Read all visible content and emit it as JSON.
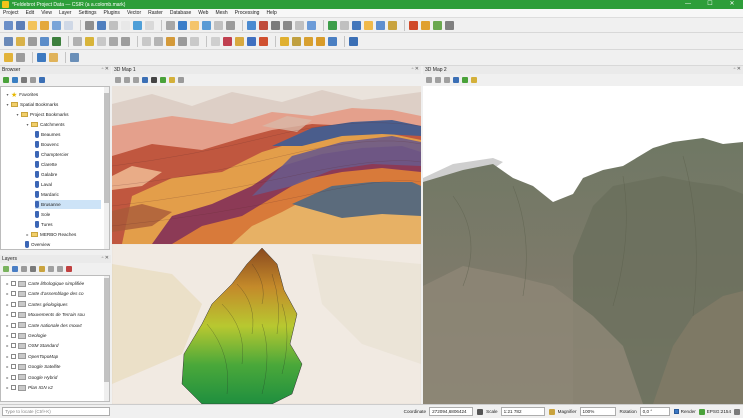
{
  "window": {
    "title": "*Feldebrot Project Data — CSIR (a a.colomb.mark)",
    "minimize": "—",
    "maximize": "☐",
    "close": "✕"
  },
  "menu": [
    "Project",
    "Edit",
    "View",
    "Layer",
    "Settings",
    "Plugins",
    "Vector",
    "Raster",
    "Database",
    "Web",
    "Mesh",
    "Processing",
    "Help"
  ],
  "toolbar_colors": {
    "row1": [
      "#6b8fc8",
      "#5d7fb8",
      "#f3c35a",
      "#e4a83b",
      "#7aa5d8",
      "#cfd8e6",
      "#8f8f8f",
      "#4f7fbf",
      "#c0c0c0",
      "#e8e8e8",
      "#4f9fd8",
      "#d9d9d9",
      "#a7a7a7",
      "#3a7dc9",
      "#f4c46b",
      "#5a9bd5",
      "#c0c0c0",
      "#9a9a9a",
      "#4a8ad0",
      "#c04b3b",
      "#7b7b7b",
      "#8a8a8a",
      "#c0c0c0",
      "#6b9bd8",
      "#3d9e4a",
      "#c0c0c0",
      "#4477bb",
      "#f0b94a",
      "#5f8fcf",
      "#c9a33e",
      "#d04a2a",
      "#e0a030",
      "#6aa84f",
      "#808080"
    ],
    "row2": [
      "#6a89b8",
      "#d9b24a",
      "#9b9b9b",
      "#5c8dc9",
      "#3d7f3d",
      "#b0b0b0",
      "#d8b43a",
      "#c8c8c8",
      "#a8a8a8",
      "#9d9d9d",
      "#c8c8c8",
      "#b4b4b4",
      "#d49a3a",
      "#9a9a9a",
      "#c9c9c9",
      "#cfcfcf",
      "#c04050",
      "#d8a940",
      "#4070c0",
      "#d05030",
      "#e0b030",
      "#c0a040",
      "#d8a030",
      "#d89b2a",
      "#4a7fc2",
      "#3b6fb5"
    ],
    "row3": [
      "#e2b33a",
      "#9c9c9c",
      "#3d79c0",
      "#e0b35a",
      "#6a8fb8"
    ]
  },
  "browser": {
    "title": "Browser",
    "items": [
      {
        "label": "Favorites",
        "indent": 0,
        "type": "star"
      },
      {
        "label": "Spatial Bookmarks",
        "indent": 0,
        "type": "folder"
      },
      {
        "label": "Project Bookmarks",
        "indent": 1,
        "type": "folder"
      },
      {
        "label": "Catchments",
        "indent": 2,
        "type": "folder"
      },
      {
        "label": "Beaumes",
        "indent": 3,
        "type": "bm"
      },
      {
        "label": "Bouvenc",
        "indent": 3,
        "type": "bm"
      },
      {
        "label": "Champtercier",
        "indent": 3,
        "type": "bm"
      },
      {
        "label": "Clarette",
        "indent": 3,
        "type": "bm"
      },
      {
        "label": "Galabre",
        "indent": 3,
        "type": "bm"
      },
      {
        "label": "Laval",
        "indent": 3,
        "type": "bm"
      },
      {
        "label": "Mardaric",
        "indent": 3,
        "type": "bm"
      },
      {
        "label": "Brusanne",
        "indent": 3,
        "type": "bm",
        "selected": true
      },
      {
        "label": "Sole",
        "indent": 3,
        "type": "bm"
      },
      {
        "label": "Tures",
        "indent": 3,
        "type": "bm"
      },
      {
        "label": "MERBO Reaches",
        "indent": 2,
        "type": "folder"
      },
      {
        "label": "Overview",
        "indent": 2,
        "type": "bm"
      }
    ]
  },
  "layers": {
    "title": "Layers",
    "items": [
      "Carte lithologique simplifiée",
      "Carte d'assemblage des co",
      "Cartes géologiques",
      "Mouvements de Terrain sou",
      "Carte nationale des mouvt",
      "Geologie",
      "OSM Standard",
      "OpenTopoMap",
      "Google Satellite",
      "Google Hybrid",
      "Plan IGN v2"
    ]
  },
  "map3d_1": {
    "title": "3D Map 1"
  },
  "map3d_2": {
    "title": "3D Map 2"
  },
  "status": {
    "search_placeholder": "Type to locate (Ctrl+K)",
    "coordinate_label": "Coordinate",
    "coordinate_value": "272094,6806424",
    "scale_label": "Scale",
    "scale_value": "1:21 782",
    "magnifier_label": "Magnifier",
    "magnifier_value": "100%",
    "rotation_label": "Rotation",
    "rotation_value": "0,0 °",
    "render_label": "Render",
    "crs_label": "EPSG:2154"
  }
}
